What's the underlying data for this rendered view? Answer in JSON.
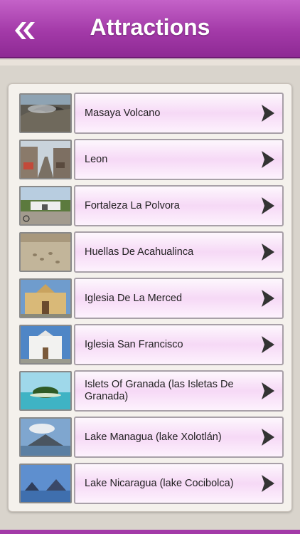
{
  "header": {
    "title": "Attractions",
    "back_icon": "double-chevron-left-icon",
    "color": "#a33aa8"
  },
  "list": {
    "items": [
      {
        "label": "Masaya Volcano",
        "thumb": "volcano-crater"
      },
      {
        "label": "Leon",
        "thumb": "street"
      },
      {
        "label": "Fortaleza La Polvora",
        "thumb": "fortress"
      },
      {
        "label": "Huellas De Acahualinca",
        "thumb": "footprints"
      },
      {
        "label": "Iglesia De La Merced",
        "thumb": "church-yellow"
      },
      {
        "label": "Iglesia San Francisco",
        "thumb": "church-white"
      },
      {
        "label": "Islets Of Granada (las Isletas De Granada)",
        "thumb": "islet"
      },
      {
        "label": "Lake Managua (lake Xolotlán)",
        "thumb": "volcano-lake"
      },
      {
        "label": "Lake Nicaragua (lake Cocibolca)",
        "thumb": "lake"
      }
    ],
    "arrow_icon": "chevron-right-icon"
  }
}
